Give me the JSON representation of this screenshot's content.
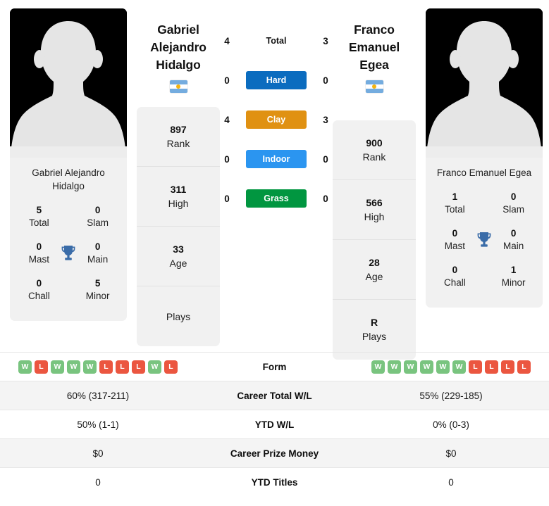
{
  "players": {
    "left": {
      "name_full": "Gabriel Alejandro Hidalgo",
      "name_line1": "Gabriel",
      "name_line2": "Alejandro",
      "name_line3": "Hidalgo",
      "flag": "argentina-flag",
      "card_stats": [
        {
          "value": "5",
          "label": "Total"
        },
        {
          "value": "0",
          "label": "Slam"
        },
        {
          "value": "0",
          "label": "Mast"
        },
        {
          "value": "0",
          "label": "Main"
        },
        {
          "value": "0",
          "label": "Chall"
        },
        {
          "value": "5",
          "label": "Minor"
        }
      ],
      "profile_stats": [
        {
          "value": "897",
          "label": "Rank"
        },
        {
          "value": "311",
          "label": "High"
        },
        {
          "value": "33",
          "label": "Age"
        },
        {
          "value": "",
          "label": "Plays"
        }
      ],
      "form": [
        "W",
        "L",
        "W",
        "W",
        "W",
        "L",
        "L",
        "L",
        "W",
        "L"
      ],
      "career_total_wl": "60% (317-211)",
      "ytd_wl": "50% (1-1)",
      "career_prize_money": "$0",
      "ytd_titles": "0"
    },
    "right": {
      "name_full": "Franco Emanuel Egea",
      "name_line1": "Franco",
      "name_line2": "Emanuel Egea",
      "flag": "argentina-flag",
      "card_stats": [
        {
          "value": "1",
          "label": "Total"
        },
        {
          "value": "0",
          "label": "Slam"
        },
        {
          "value": "0",
          "label": "Mast"
        },
        {
          "value": "0",
          "label": "Main"
        },
        {
          "value": "0",
          "label": "Chall"
        },
        {
          "value": "1",
          "label": "Minor"
        }
      ],
      "profile_stats": [
        {
          "value": "900",
          "label": "Rank"
        },
        {
          "value": "566",
          "label": "High"
        },
        {
          "value": "28",
          "label": "Age"
        },
        {
          "value": "R",
          "label": "Plays"
        }
      ],
      "form": [
        "W",
        "W",
        "W",
        "W",
        "W",
        "W",
        "L",
        "L",
        "L",
        "L"
      ],
      "career_total_wl": "55% (229-185)",
      "ytd_wl": "0% (0-3)",
      "career_prize_money": "$0",
      "ytd_titles": "0"
    }
  },
  "surfaces": [
    {
      "label": "Total",
      "left": "4",
      "right": "3",
      "color": "transparent",
      "filled": false
    },
    {
      "label": "Hard",
      "left": "0",
      "right": "0",
      "color": "#0b6cbf",
      "filled": true
    },
    {
      "label": "Clay",
      "left": "4",
      "right": "3",
      "color": "#e09112",
      "filled": true
    },
    {
      "label": "Indoor",
      "left": "0",
      "right": "0",
      "color": "#2b95f0",
      "filled": true
    },
    {
      "label": "Grass",
      "left": "0",
      "right": "0",
      "color": "#019640",
      "filled": true
    }
  ],
  "table": {
    "rows": [
      {
        "label": "Form",
        "type": "form"
      },
      {
        "label": "Career Total W/L",
        "left": "60% (317-211)",
        "right": "55% (229-185)"
      },
      {
        "label": "YTD W/L",
        "left": "50% (1-1)",
        "right": "0% (0-3)"
      },
      {
        "label": "Career Prize Money",
        "left": "$0",
        "right": "$0"
      },
      {
        "label": "YTD Titles",
        "left": "0",
        "right": "0"
      }
    ]
  },
  "colors": {
    "win_badge": "#79c47f",
    "loss_badge": "#eb5640",
    "card_bg": "#f1f1f1",
    "trophy": "#3a6ca8"
  },
  "icons": {
    "trophy": "trophy-icon",
    "avatar": "player-avatar-silhouette"
  }
}
